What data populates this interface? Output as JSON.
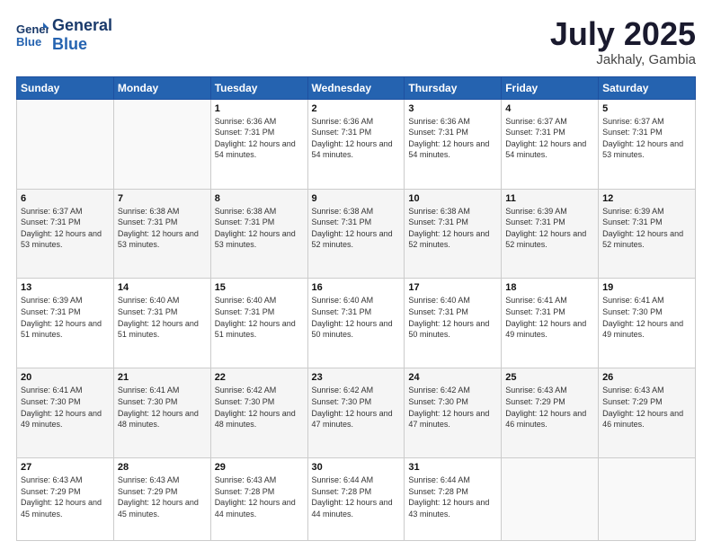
{
  "header": {
    "logo_line1": "General",
    "logo_line2": "Blue",
    "month": "July 2025",
    "location": "Jakhaly, Gambia"
  },
  "weekdays": [
    "Sunday",
    "Monday",
    "Tuesday",
    "Wednesday",
    "Thursday",
    "Friday",
    "Saturday"
  ],
  "weeks": [
    [
      {
        "day": "",
        "info": ""
      },
      {
        "day": "",
        "info": ""
      },
      {
        "day": "1",
        "info": "Sunrise: 6:36 AM\nSunset: 7:31 PM\nDaylight: 12 hours and 54 minutes."
      },
      {
        "day": "2",
        "info": "Sunrise: 6:36 AM\nSunset: 7:31 PM\nDaylight: 12 hours and 54 minutes."
      },
      {
        "day": "3",
        "info": "Sunrise: 6:36 AM\nSunset: 7:31 PM\nDaylight: 12 hours and 54 minutes."
      },
      {
        "day": "4",
        "info": "Sunrise: 6:37 AM\nSunset: 7:31 PM\nDaylight: 12 hours and 54 minutes."
      },
      {
        "day": "5",
        "info": "Sunrise: 6:37 AM\nSunset: 7:31 PM\nDaylight: 12 hours and 53 minutes."
      }
    ],
    [
      {
        "day": "6",
        "info": "Sunrise: 6:37 AM\nSunset: 7:31 PM\nDaylight: 12 hours and 53 minutes."
      },
      {
        "day": "7",
        "info": "Sunrise: 6:38 AM\nSunset: 7:31 PM\nDaylight: 12 hours and 53 minutes."
      },
      {
        "day": "8",
        "info": "Sunrise: 6:38 AM\nSunset: 7:31 PM\nDaylight: 12 hours and 53 minutes."
      },
      {
        "day": "9",
        "info": "Sunrise: 6:38 AM\nSunset: 7:31 PM\nDaylight: 12 hours and 52 minutes."
      },
      {
        "day": "10",
        "info": "Sunrise: 6:38 AM\nSunset: 7:31 PM\nDaylight: 12 hours and 52 minutes."
      },
      {
        "day": "11",
        "info": "Sunrise: 6:39 AM\nSunset: 7:31 PM\nDaylight: 12 hours and 52 minutes."
      },
      {
        "day": "12",
        "info": "Sunrise: 6:39 AM\nSunset: 7:31 PM\nDaylight: 12 hours and 52 minutes."
      }
    ],
    [
      {
        "day": "13",
        "info": "Sunrise: 6:39 AM\nSunset: 7:31 PM\nDaylight: 12 hours and 51 minutes."
      },
      {
        "day": "14",
        "info": "Sunrise: 6:40 AM\nSunset: 7:31 PM\nDaylight: 12 hours and 51 minutes."
      },
      {
        "day": "15",
        "info": "Sunrise: 6:40 AM\nSunset: 7:31 PM\nDaylight: 12 hours and 51 minutes."
      },
      {
        "day": "16",
        "info": "Sunrise: 6:40 AM\nSunset: 7:31 PM\nDaylight: 12 hours and 50 minutes."
      },
      {
        "day": "17",
        "info": "Sunrise: 6:40 AM\nSunset: 7:31 PM\nDaylight: 12 hours and 50 minutes."
      },
      {
        "day": "18",
        "info": "Sunrise: 6:41 AM\nSunset: 7:31 PM\nDaylight: 12 hours and 49 minutes."
      },
      {
        "day": "19",
        "info": "Sunrise: 6:41 AM\nSunset: 7:30 PM\nDaylight: 12 hours and 49 minutes."
      }
    ],
    [
      {
        "day": "20",
        "info": "Sunrise: 6:41 AM\nSunset: 7:30 PM\nDaylight: 12 hours and 49 minutes."
      },
      {
        "day": "21",
        "info": "Sunrise: 6:41 AM\nSunset: 7:30 PM\nDaylight: 12 hours and 48 minutes."
      },
      {
        "day": "22",
        "info": "Sunrise: 6:42 AM\nSunset: 7:30 PM\nDaylight: 12 hours and 48 minutes."
      },
      {
        "day": "23",
        "info": "Sunrise: 6:42 AM\nSunset: 7:30 PM\nDaylight: 12 hours and 47 minutes."
      },
      {
        "day": "24",
        "info": "Sunrise: 6:42 AM\nSunset: 7:30 PM\nDaylight: 12 hours and 47 minutes."
      },
      {
        "day": "25",
        "info": "Sunrise: 6:43 AM\nSunset: 7:29 PM\nDaylight: 12 hours and 46 minutes."
      },
      {
        "day": "26",
        "info": "Sunrise: 6:43 AM\nSunset: 7:29 PM\nDaylight: 12 hours and 46 minutes."
      }
    ],
    [
      {
        "day": "27",
        "info": "Sunrise: 6:43 AM\nSunset: 7:29 PM\nDaylight: 12 hours and 45 minutes."
      },
      {
        "day": "28",
        "info": "Sunrise: 6:43 AM\nSunset: 7:29 PM\nDaylight: 12 hours and 45 minutes."
      },
      {
        "day": "29",
        "info": "Sunrise: 6:43 AM\nSunset: 7:28 PM\nDaylight: 12 hours and 44 minutes."
      },
      {
        "day": "30",
        "info": "Sunrise: 6:44 AM\nSunset: 7:28 PM\nDaylight: 12 hours and 44 minutes."
      },
      {
        "day": "31",
        "info": "Sunrise: 6:44 AM\nSunset: 7:28 PM\nDaylight: 12 hours and 43 minutes."
      },
      {
        "day": "",
        "info": ""
      },
      {
        "day": "",
        "info": ""
      }
    ]
  ]
}
